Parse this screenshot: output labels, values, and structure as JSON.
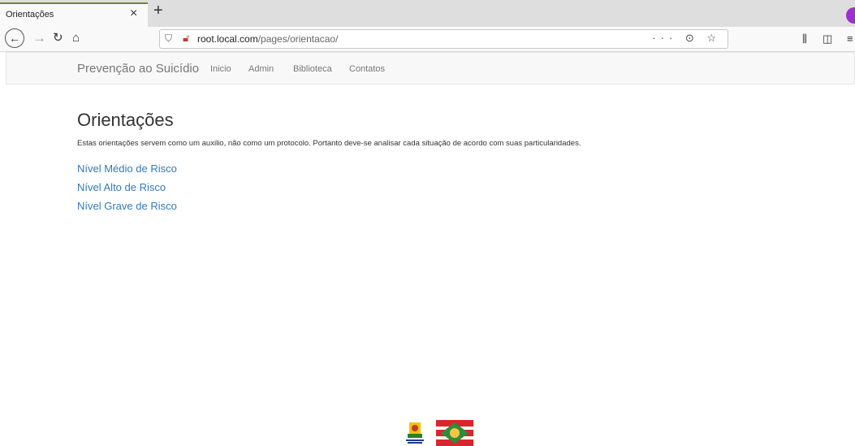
{
  "browser": {
    "tab_title": "Orientações",
    "tab_close": "×",
    "new_tab": "+",
    "url_host": "root.local.com",
    "url_path": "/pages/orientacao/",
    "url_prefix": "",
    "url_actions": "··· ⊙ ☆"
  },
  "site": {
    "brand": "Prevenção ao Suicídio",
    "nav": [
      "Inicio",
      "Admin",
      "Biblioteca",
      "Contatos"
    ]
  },
  "main": {
    "title": "Orientações",
    "intro": "Estas orientações servem como um auxilio, não como um protocolo. Portanto deve-se analisar cada situação de acordo com suas particularidades.",
    "links": [
      "Nível Médio de Risco",
      "Nível Alto de Risco",
      "Nível Grave de Risco"
    ]
  },
  "colors": {
    "link": "#337ab7",
    "accent_tab": "#6f8a2b",
    "profile": "#9f2ed6"
  }
}
